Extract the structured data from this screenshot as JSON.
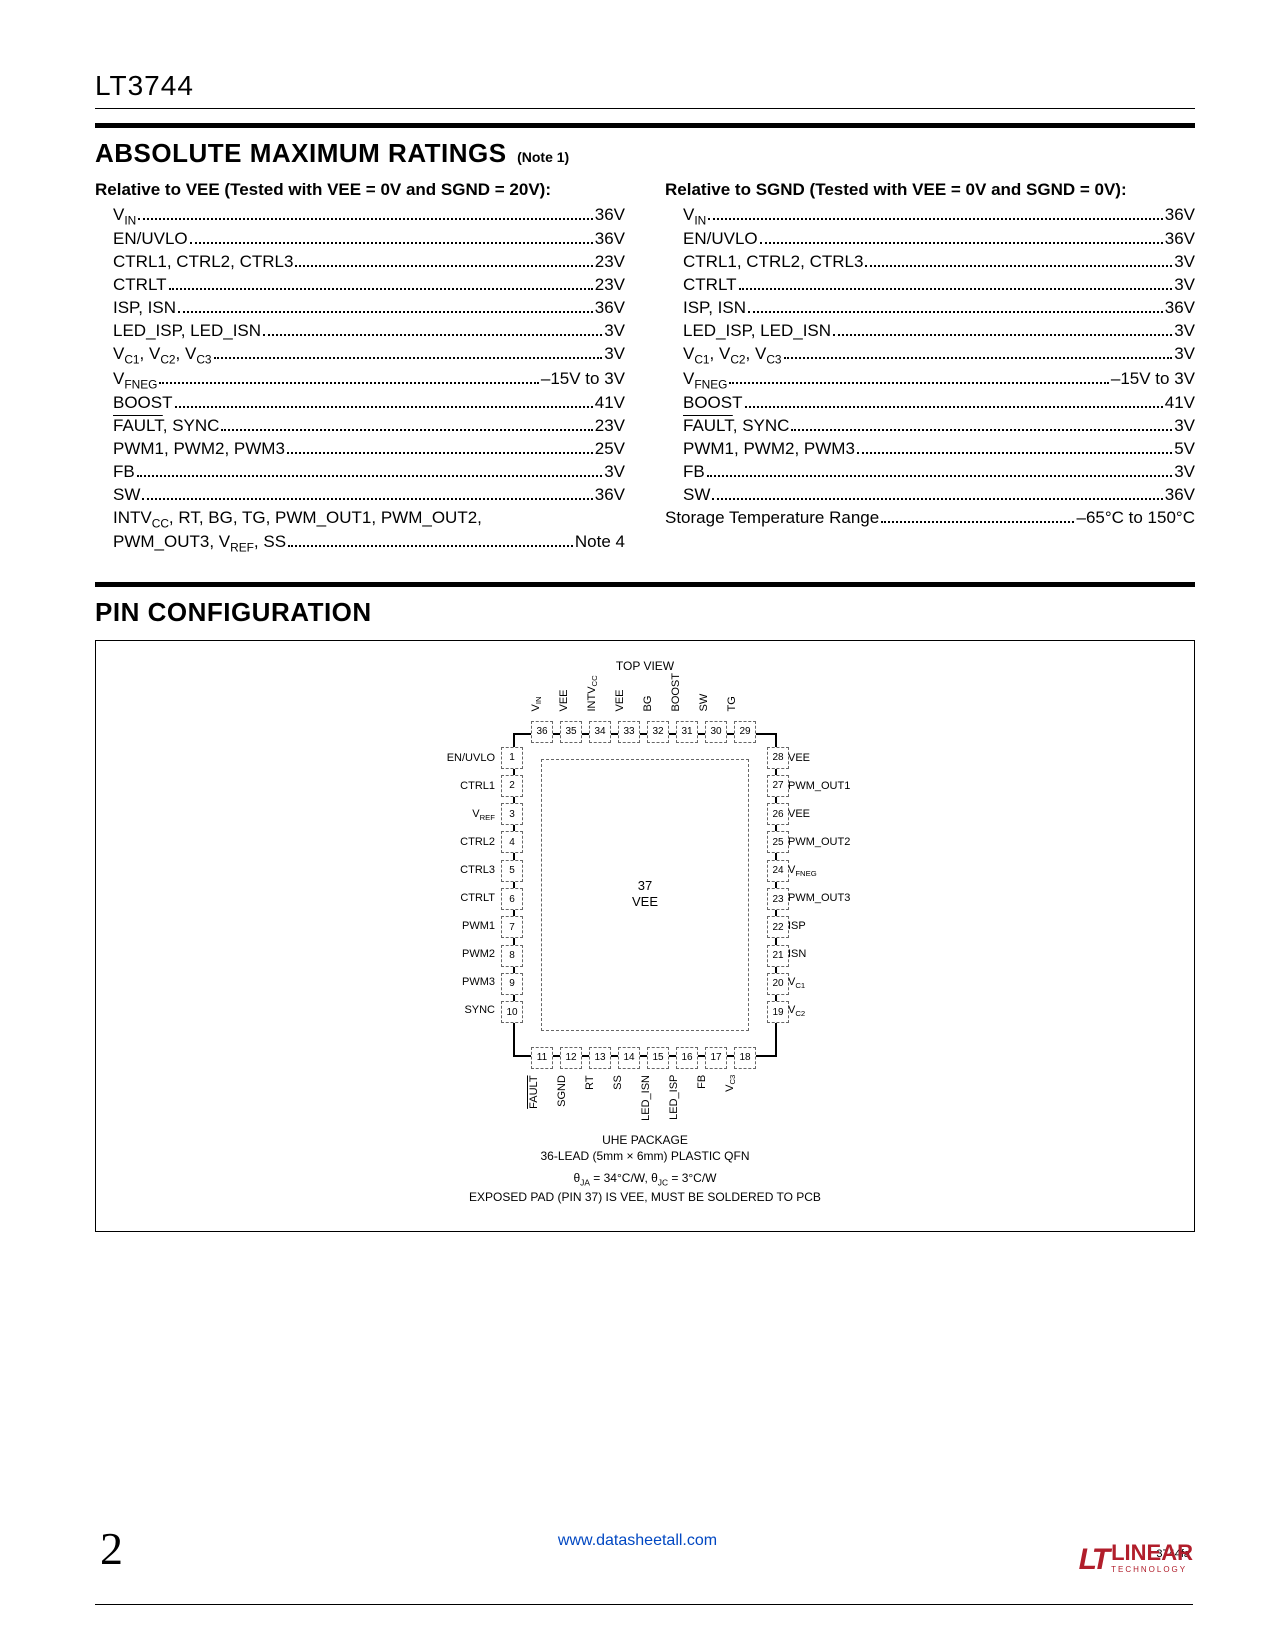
{
  "part_number": "LT3744",
  "section1": {
    "title": "ABSOLUTE MAXIMUM RATINGS",
    "note": "(Note 1)"
  },
  "col_left": {
    "header": "Relative to VEE (Tested with VEE = 0V and SGND = 20V):",
    "rows": [
      {
        "l": "V<sub>IN</sub>",
        "v": "36V"
      },
      {
        "l": "EN/UVLO",
        "v": "36V"
      },
      {
        "l": "CTRL1, CTRL2, CTRL3",
        "v": "23V"
      },
      {
        "l": "CTRLT",
        "v": "23V"
      },
      {
        "l": "ISP, ISN",
        "v": "36V"
      },
      {
        "l": "LED_ISP, LED_ISN",
        "v": "3V"
      },
      {
        "l": "V<sub>C1</sub>, V<sub>C2</sub>, V<sub>C3</sub>",
        "v": "3V"
      },
      {
        "l": "V<sub>FNEG</sub>",
        "v": "–15V to 3V"
      },
      {
        "l": "BOOST",
        "v": "41V"
      },
      {
        "l": "<span class='overline'>FAULT</span>, SYNC",
        "v": "23V"
      },
      {
        "l": "PWM1, PWM2, PWM3",
        "v": "25V"
      },
      {
        "l": "FB",
        "v": "3V"
      },
      {
        "l": "SW",
        "v": "36V"
      },
      {
        "l": "INTV<sub>CC</sub>, RT, BG, TG, PWM_OUT1, PWM_OUT2, PWM_OUT3, V<sub>REF</sub>, SS",
        "v": "Note 4",
        "wrap": true
      }
    ]
  },
  "col_right": {
    "header": "Relative to SGND (Tested with VEE = 0V and SGND = 0V):",
    "rows": [
      {
        "l": "V<sub>IN</sub>",
        "v": "36V"
      },
      {
        "l": "EN/UVLO",
        "v": "36V"
      },
      {
        "l": "CTRL1, CTRL2, CTRL3",
        "v": "3V"
      },
      {
        "l": "CTRLT",
        "v": "3V"
      },
      {
        "l": "ISP, ISN",
        "v": "36V"
      },
      {
        "l": "LED_ISP, LED_ISN",
        "v": "3V"
      },
      {
        "l": "V<sub>C1</sub>, V<sub>C2</sub>, V<sub>C3</sub>",
        "v": "3V"
      },
      {
        "l": "V<sub>FNEG</sub>",
        "v": "–15V to 3V"
      },
      {
        "l": "BOOST",
        "v": "41V"
      },
      {
        "l": "<span class='overline'>FAULT</span>, SYNC",
        "v": "3V"
      },
      {
        "l": "PWM1, PWM2, PWM3",
        "v": "5V"
      },
      {
        "l": "FB",
        "v": "3V"
      },
      {
        "l": "SW",
        "v": "36V"
      },
      {
        "l": "Storage Temperature Range",
        "v": "–65°C to 150°C",
        "noindent": true
      }
    ]
  },
  "section2": {
    "title": "PIN CONFIGURATION"
  },
  "pin": {
    "topview": "TOP VIEW",
    "die": {
      "num": "37",
      "name": "VEE"
    },
    "left_labels": [
      "EN/UVLO",
      "CTRL1",
      "V<sub>REF</sub>",
      "CTRL2",
      "CTRL3",
      "CTRLT",
      "PWM1",
      "PWM2",
      "PWM3",
      "SYNC"
    ],
    "left_nums": [
      "1",
      "2",
      "3",
      "4",
      "5",
      "6",
      "7",
      "8",
      "9",
      "10"
    ],
    "right_labels": [
      "VEE",
      "PWM_OUT1",
      "VEE",
      "PWM_OUT2",
      "V<sub>FNEG</sub>",
      "PWM_OUT3",
      "ISP",
      "ISN",
      "V<sub>C1</sub>",
      "V<sub>C2</sub>"
    ],
    "right_nums": [
      "28",
      "27",
      "26",
      "25",
      "24",
      "23",
      "22",
      "21",
      "20",
      "19"
    ],
    "top_labels": [
      "V<sub>IN</sub>",
      "VEE",
      "INTV<sub>CC</sub>",
      "VEE",
      "BG",
      "BOOST",
      "SW",
      "TG"
    ],
    "top_nums": [
      "36",
      "35",
      "34",
      "33",
      "32",
      "31",
      "30",
      "29"
    ],
    "bottom_labels": [
      "<span class='overline'>FAULT</span>",
      "SGND",
      "RT",
      "SS",
      "LED_ISN",
      "LED_ISP",
      "FB",
      "V<sub>C3</sub>"
    ],
    "bottom_nums": [
      "11",
      "12",
      "13",
      "14",
      "15",
      "16",
      "17",
      "18"
    ],
    "pkg1": "UHE PACKAGE",
    "pkg2": "36-LEAD (5mm × 6mm) PLASTIC QFN",
    "pkg3": "θ<sub>JA</sub> = 34°C/W, θ<sub>JC</sub> = 3°C/W",
    "pkg4": "EXPOSED PAD (PIN 37) IS VEE, MUST BE SOLDERED TO PCB"
  },
  "footer": {
    "page": "2",
    "url": "www.datasheetall.com",
    "doccode": "3744fa",
    "logo_text": "LINEAR",
    "logo_sub": "TECHNOLOGY"
  }
}
